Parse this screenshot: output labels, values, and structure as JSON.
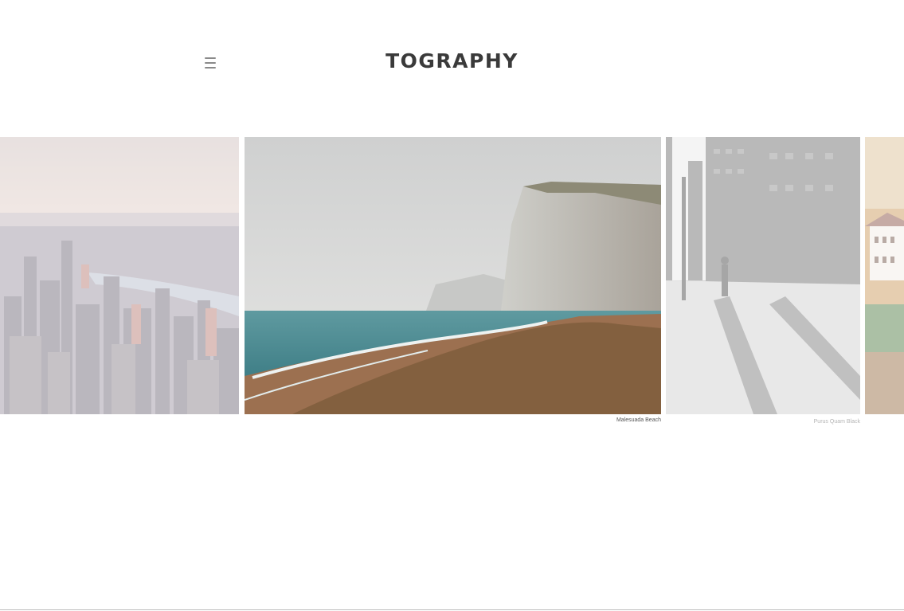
{
  "header": {
    "logo_text": "TOGRAPHY",
    "menu_icon": "hamburger-menu-icon"
  },
  "slider": {
    "slides": [
      {
        "name": "city-skyline-slide",
        "caption": ""
      },
      {
        "name": "beach-cliff-slide",
        "caption": "Malesuada Beach"
      },
      {
        "name": "street-slide",
        "caption": "Purus Quam Black"
      },
      {
        "name": "village-slide",
        "caption": ""
      }
    ]
  }
}
